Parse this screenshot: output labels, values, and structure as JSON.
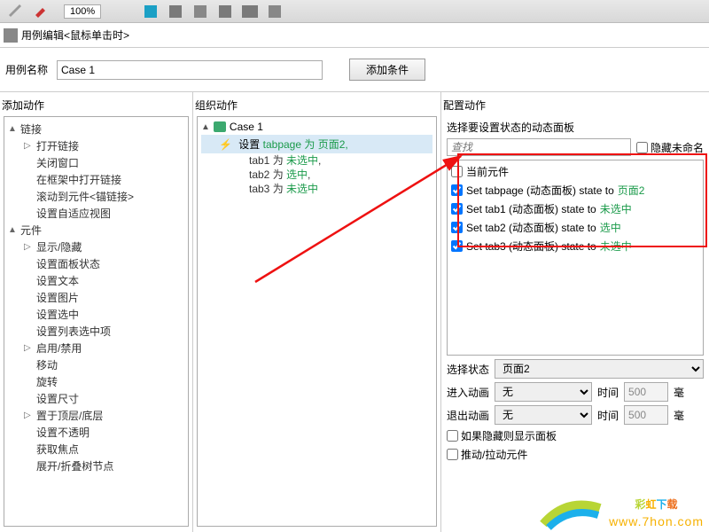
{
  "toolbar": {
    "zoom": "100%"
  },
  "header": {
    "title": "用例编辑<鼠标单击时>"
  },
  "namerow": {
    "label": "用例名称",
    "value": "Case 1",
    "add_condition": "添加条件"
  },
  "columns": {
    "add_action": "添加动作",
    "organize_action": "组织动作",
    "config_action": "配置动作"
  },
  "tree": {
    "links": {
      "label": "链接",
      "open": "打开链接",
      "close": "关闭窗口",
      "openframe": "在框架中打开链接",
      "scroll": "滚动到元件<锚链接>",
      "adaptive": "设置自适应视图"
    },
    "widgets": {
      "label": "元件",
      "showhide": "显示/隐藏",
      "panelstate": "设置面板状态",
      "settext": "设置文本",
      "setimage": "设置图片",
      "setsel": "设置选中",
      "setlistsel": "设置列表选中项",
      "enable": "启用/禁用",
      "move": "移动",
      "rotate": "旋转",
      "setsize": "设置尺寸",
      "bring": "置于顶层/底层",
      "opacity": "设置不透明",
      "focus": "获取焦点",
      "expand": "展开/折叠树节点"
    }
  },
  "org": {
    "case": "Case 1",
    "set_label": "设置",
    "set_target": "tabpage 为 ",
    "set_value": "页面2",
    "lines": [
      {
        "pre": "tab1 为 ",
        "val": "未选中"
      },
      {
        "pre": "tab2 为 ",
        "val": "选中"
      },
      {
        "pre": "tab3 为 ",
        "val": "未选中"
      }
    ]
  },
  "cfg": {
    "title": "选择要设置状态的动态面板",
    "search_ph": "查找",
    "hide_unnamed": "隐藏未命名",
    "current_widget": "当前元件",
    "items": [
      {
        "pre": "Set tabpage (动态面板) state to ",
        "val": "页面2"
      },
      {
        "pre": "Set tab1 (动态面板) state to ",
        "val": "未选中"
      },
      {
        "pre": "Set tab2 (动态面板) state to ",
        "val": "选中"
      },
      {
        "pre": "Set tab3 (动态面板) state to ",
        "val": "未选中"
      }
    ],
    "select_state": "选择状态",
    "state_val": "页面2",
    "enter_anim": "进入动画",
    "exit_anim": "退出动画",
    "none": "无",
    "time": "时间",
    "time_val": "500",
    "ms": "毫",
    "show_if_hidden": "如果隐藏则显示面板",
    "push_pull": "推动/拉动元件"
  },
  "logo": {
    "zh": "彩虹下载",
    "url": "www.7hon.com"
  }
}
